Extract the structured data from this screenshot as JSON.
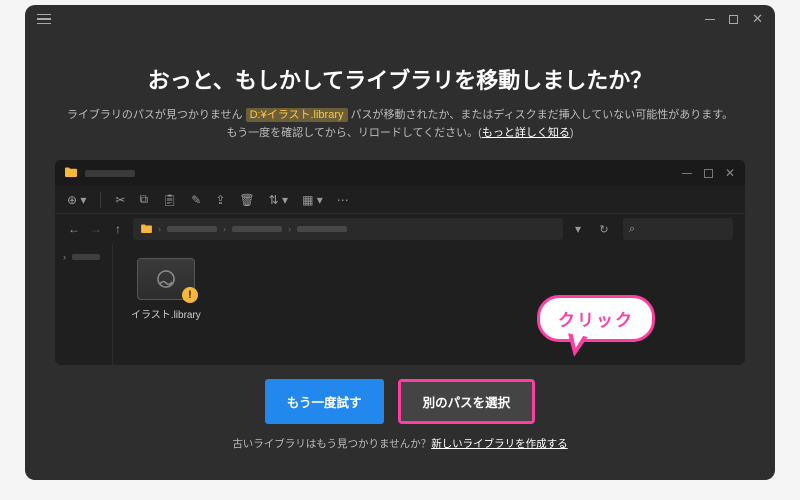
{
  "titlebar": {
    "minimize_char": "—",
    "close_char": "✕"
  },
  "heading": "おっと、もしかしてライブラリを移動しましたか？",
  "sub": {
    "part1": "ライブラリのパスが見つかりません ",
    "path": "D:¥イラスト.library",
    "part2": " パスが移動されたか、またはディスクまだ挿入していない可能性があります。",
    "part3": "もう一度を確認してから、リロードしてください。(",
    "learn_more": "もっと詳しく知る",
    "part4": ")"
  },
  "explorer": {
    "refresh_icon": "↻",
    "search_icon": "⌕",
    "library_label": "イラスト.library",
    "warn_char": "!"
  },
  "actions": {
    "retry": "もう一度試す",
    "select_other": "別のパスを選択"
  },
  "footer": {
    "prefix": "古いライブラリはもう見つかりませんか？",
    "link": "新しいライブラリを作成する"
  },
  "callout": "クリック"
}
